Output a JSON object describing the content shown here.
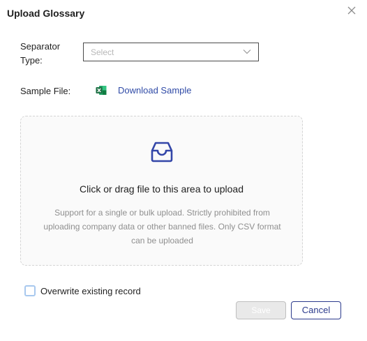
{
  "dialog": {
    "title": "Upload Glossary"
  },
  "separator": {
    "label_line1": "Separator",
    "label_line2": "Type:",
    "placeholder": "Select"
  },
  "sample": {
    "label": "Sample File:",
    "link_text": "Download Sample",
    "icon": "excel-icon"
  },
  "dropzone": {
    "icon": "inbox-icon",
    "title": "Click or drag file to this area to upload",
    "hint_line1": "Support for a single or bulk upload. Strictly prohibited from",
    "hint_line2": "uploading company data or other banned files. Only CSV format",
    "hint_line3": "can be uploaded"
  },
  "overwrite": {
    "label": "Overwrite existing record",
    "checked": false
  },
  "buttons": {
    "save_label": "Save",
    "cancel_label": "Cancel"
  },
  "colors": {
    "accent": "#2b3a8c",
    "link": "#2f4aa6",
    "excel_green": "#1d7044"
  }
}
